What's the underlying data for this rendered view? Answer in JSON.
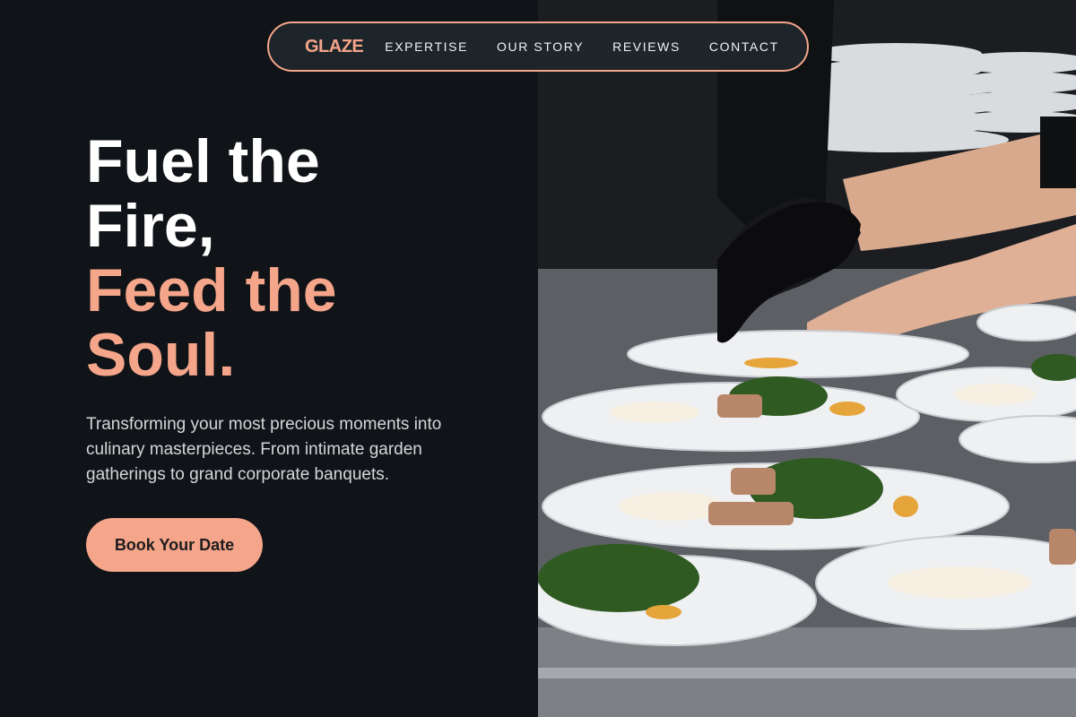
{
  "nav": {
    "logo": "GLAZE",
    "links": [
      "EXPERTISE",
      "OUR STORY",
      "REVIEWS",
      "CONTACT"
    ]
  },
  "hero": {
    "headline_line1": "Fuel the",
    "headline_line2": "Fire,",
    "headline_line3": "Feed the",
    "headline_line4": "Soul.",
    "subtitle": "Transforming your most precious moments into culinary masterpieces. From intimate garden gatherings to grand corporate banquets.",
    "cta_label": "Book Your Date"
  },
  "image": {
    "subject": "chef-plating-dishes-photo"
  },
  "colors": {
    "accent": "#f4a58a",
    "background": "#101317",
    "text": "#ffffff"
  }
}
